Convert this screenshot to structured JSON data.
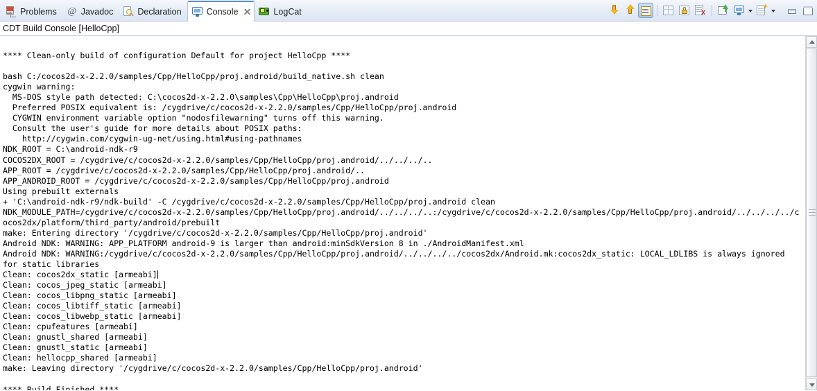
{
  "tabs": [
    {
      "id": "problems",
      "label": "Problems",
      "icon": "problems-icon",
      "active": false,
      "closeable": false
    },
    {
      "id": "javadoc",
      "label": "Javadoc",
      "icon": "javadoc-icon",
      "active": false,
      "closeable": false
    },
    {
      "id": "declaration",
      "label": "Declaration",
      "icon": "declaration-icon",
      "active": false,
      "closeable": false
    },
    {
      "id": "console",
      "label": "Console",
      "icon": "console-icon",
      "active": true,
      "closeable": true
    },
    {
      "id": "logcat",
      "label": "LogCat",
      "icon": "logcat-icon",
      "active": false,
      "closeable": false
    }
  ],
  "toolbar": {
    "buttons": [
      {
        "id": "scroll-lock-down",
        "icon": "arrow-down-icon",
        "tooltip": "Scroll Lock Down"
      },
      {
        "id": "scroll-lock-up",
        "icon": "arrow-up-icon",
        "tooltip": "Scroll Lock Up"
      },
      {
        "id": "word-wrap",
        "icon": "word-wrap-icon",
        "tooltip": "Word Wrap",
        "pressed": true
      },
      {
        "id": "clear-console",
        "icon": "grid-icon",
        "tooltip": "Clear Console"
      },
      {
        "id": "scroll-lock",
        "icon": "lock-icon",
        "tooltip": "Scroll Lock"
      },
      {
        "id": "remove-console",
        "icon": "clear-page-icon",
        "tooltip": "Remove Console"
      },
      {
        "id": "pin-console",
        "icon": "pin-icon",
        "tooltip": "Pin Console"
      },
      {
        "id": "display-console",
        "icon": "display-icon",
        "tooltip": "Display Selected Console"
      },
      {
        "id": "open-console",
        "icon": "new-console-icon",
        "tooltip": "Open Console"
      },
      {
        "id": "minimize-view",
        "icon": "minimize-icon",
        "tooltip": "Minimize"
      },
      {
        "id": "maximize-view",
        "icon": "maximize-icon",
        "tooltip": "Maximize"
      }
    ]
  },
  "view": {
    "title": "CDT Build Console [HelloCpp]"
  },
  "console": {
    "lines": [
      "",
      "**** Clean-only build of configuration Default for project HelloCpp ****",
      "",
      "bash C:/cocos2d-x-2.2.0/samples/Cpp/HelloCpp/proj.android/build_native.sh clean",
      "cygwin warning:",
      "  MS-DOS style path detected: C:\\cocos2d-x-2.2.0\\samples\\Cpp\\HelloCpp\\proj.android",
      "  Preferred POSIX equivalent is: /cygdrive/c/cocos2d-x-2.2.0/samples/Cpp/HelloCpp/proj.android",
      "  CYGWIN environment variable option \"nodosfilewarning\" turns off this warning.",
      "  Consult the user's guide for more details about POSIX paths:",
      "    http://cygwin.com/cygwin-ug-net/using.html#using-pathnames",
      "NDK_ROOT = C:\\android-ndk-r9",
      "COCOS2DX_ROOT = /cygdrive/c/cocos2d-x-2.2.0/samples/Cpp/HelloCpp/proj.android/../../../..",
      "APP_ROOT = /cygdrive/c/cocos2d-x-2.2.0/samples/Cpp/HelloCpp/proj.android/..",
      "APP_ANDROID_ROOT = /cygdrive/c/cocos2d-x-2.2.0/samples/Cpp/HelloCpp/proj.android",
      "Using prebuilt externals",
      "+ 'C:\\android-ndk-r9/ndk-build' -C /cygdrive/c/cocos2d-x-2.2.0/samples/Cpp/HelloCpp/proj.android clean",
      "NDK_MODULE_PATH=/cygdrive/c/cocos2d-x-2.2.0/samples/Cpp/HelloCpp/proj.android/../../../..:/cygdrive/c/cocos2d-x-2.2.0/samples/Cpp/HelloCpp/proj.android/../../../../c",
      "ocos2dx/platform/third_party/android/prebuilt",
      "make: Entering directory '/cygdrive/c/cocos2d-x-2.2.0/samples/Cpp/HelloCpp/proj.android'",
      "Android NDK: WARNING: APP_PLATFORM android-9 is larger than android:minSdkVersion 8 in ./AndroidManifest.xml",
      "Android NDK: WARNING:/cygdrive/c/cocos2d-x-2.2.0/samples/Cpp/HelloCpp/proj.android/../../../../cocos2dx/Android.mk:cocos2dx_static: LOCAL_LDLIBS is always ignored",
      "for static libraries",
      "Clean: cocos2dx_static [armeabi]",
      "Clean: cocos_jpeg_static [armeabi]",
      "Clean: cocos_libpng_static [armeabi]",
      "Clean: cocos_libtiff_static [armeabi]",
      "Clean: cocos_libwebp_static [armeabi]",
      "Clean: cpufeatures [armeabi]",
      "Clean: gnustl_shared [armeabi]",
      "Clean: gnustl_static [armeabi]",
      "Clean: hellocpp_shared [armeabi]",
      "make: Leaving directory '/cygdrive/c/cocos2d-x-2.2.0/samples/Cpp/HelloCpp/proj.android'",
      "",
      "**** Build Finished ****"
    ],
    "caret_line_index": 22
  },
  "scrollbar": {
    "up_arrow": "scroll-up-arrow-icon",
    "down_arrow": "scroll-down-arrow-icon",
    "thumb": "scroll-thumb"
  },
  "colors": {
    "accent": "#5a8fd4",
    "tabbar_bg": "#e8eef7",
    "console_bg": "#ffffff",
    "text": "#000000"
  }
}
